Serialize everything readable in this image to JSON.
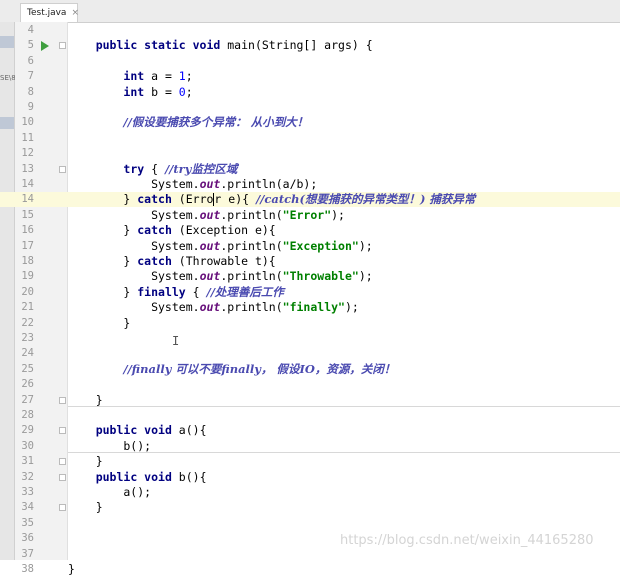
{
  "editor": {
    "tab": {
      "filename": "Test.java",
      "close_glyph": "×",
      "icon": "java-class-icon"
    },
    "side_text": "SE\\8",
    "watermark": "https://blog.csdn.net/weixin_44165280",
    "caret_line": "14",
    "lines": [
      {
        "n": "4",
        "t": []
      },
      {
        "n": "5",
        "t": [
          [
            "    ",
            ""
          ],
          [
            "public static void",
            "kw"
          ],
          [
            " main(String[] args) {",
            ""
          ]
        ]
      },
      {
        "n": "6",
        "t": []
      },
      {
        "n": "7",
        "t": [
          [
            "        ",
            ""
          ],
          [
            "int",
            "kw"
          ],
          [
            " a = ",
            ""
          ],
          [
            "1",
            "num"
          ],
          [
            ";",
            ""
          ]
        ]
      },
      {
        "n": "8",
        "t": [
          [
            "        ",
            ""
          ],
          [
            "int",
            "kw"
          ],
          [
            " b = ",
            ""
          ],
          [
            "0",
            "num"
          ],
          [
            ";",
            ""
          ]
        ]
      },
      {
        "n": "9",
        "t": []
      },
      {
        "n": "10",
        "t": [
          [
            "        ",
            ""
          ],
          [
            "//假设要捕获多个异常： 从小到大！",
            "cmt"
          ]
        ]
      },
      {
        "n": "11",
        "t": []
      },
      {
        "n": "12",
        "t": []
      },
      {
        "n": "13",
        "t": [
          [
            "        ",
            ""
          ],
          [
            "try",
            "kw"
          ],
          [
            " { ",
            ""
          ],
          [
            "//try监控区域",
            "cmt"
          ]
        ]
      },
      {
        "n": "14",
        "t": [
          [
            "            System.",
            ""
          ],
          [
            "out",
            "fld"
          ],
          [
            ".println(a/b);",
            ""
          ]
        ]
      },
      {
        "n": "14",
        "t": [
          [
            "        } ",
            ""
          ],
          [
            "catch",
            "kw"
          ],
          [
            " (Erro",
            ""
          ],
          [
            "|",
            "caret"
          ],
          [
            "r e){ ",
            ""
          ],
          [
            "//catch(想要捕获的异常类型！) 捕获异常",
            "cmt"
          ]
        ]
      },
      {
        "n": "15",
        "t": [
          [
            "            System.",
            ""
          ],
          [
            "out",
            "fld"
          ],
          [
            ".println(",
            ""
          ],
          [
            "\"Error\"",
            "str"
          ],
          [
            ");",
            ""
          ]
        ]
      },
      {
        "n": "16",
        "t": [
          [
            "        } ",
            ""
          ],
          [
            "catch",
            "kw"
          ],
          [
            " (Exception e){",
            ""
          ]
        ]
      },
      {
        "n": "17",
        "t": [
          [
            "            System.",
            ""
          ],
          [
            "out",
            "fld"
          ],
          [
            ".println(",
            ""
          ],
          [
            "\"Exception\"",
            "str"
          ],
          [
            ");",
            ""
          ]
        ]
      },
      {
        "n": "18",
        "t": [
          [
            "        } ",
            ""
          ],
          [
            "catch",
            "kw"
          ],
          [
            " (Throwable t){",
            ""
          ]
        ]
      },
      {
        "n": "19",
        "t": [
          [
            "            System.",
            ""
          ],
          [
            "out",
            "fld"
          ],
          [
            ".println(",
            ""
          ],
          [
            "\"Throwable\"",
            "str"
          ],
          [
            ");",
            ""
          ]
        ]
      },
      {
        "n": "20",
        "t": [
          [
            "        } ",
            ""
          ],
          [
            "finally",
            "kw"
          ],
          [
            " { ",
            ""
          ],
          [
            "//处理善后工作",
            "cmt"
          ]
        ]
      },
      {
        "n": "21",
        "t": [
          [
            "            System.",
            ""
          ],
          [
            "out",
            "fld"
          ],
          [
            ".println(",
            ""
          ],
          [
            "\"finally\"",
            "str"
          ],
          [
            ");",
            ""
          ]
        ]
      },
      {
        "n": "22",
        "t": [
          [
            "        }",
            ""
          ]
        ]
      },
      {
        "n": "23",
        "t": []
      },
      {
        "n": "24",
        "t": []
      },
      {
        "n": "25",
        "t": [
          [
            "        ",
            ""
          ],
          [
            "//finally 可以不要finally， 假设IO，资源，关闭！",
            "cmt"
          ]
        ]
      },
      {
        "n": "26",
        "t": []
      },
      {
        "n": "27",
        "t": [
          [
            "    }",
            ""
          ]
        ]
      },
      {
        "n": "28",
        "t": []
      },
      {
        "n": "29",
        "t": [
          [
            "    ",
            ""
          ],
          [
            "public void",
            "kw"
          ],
          [
            " a(){",
            ""
          ]
        ]
      },
      {
        "n": "30",
        "t": [
          [
            "        b();",
            ""
          ]
        ]
      },
      {
        "n": "31",
        "t": [
          [
            "    }",
            ""
          ]
        ]
      },
      {
        "n": "32",
        "t": [
          [
            "    ",
            ""
          ],
          [
            "public void",
            "kw"
          ],
          [
            " b(){",
            ""
          ]
        ]
      },
      {
        "n": "33",
        "t": [
          [
            "        a();",
            ""
          ]
        ]
      },
      {
        "n": "34",
        "t": [
          [
            "    }",
            ""
          ]
        ]
      },
      {
        "n": "35",
        "t": []
      },
      {
        "n": "36",
        "t": []
      },
      {
        "n": "37",
        "t": []
      },
      {
        "n": "38",
        "t": [
          [
            "}",
            ""
          ]
        ]
      }
    ]
  }
}
